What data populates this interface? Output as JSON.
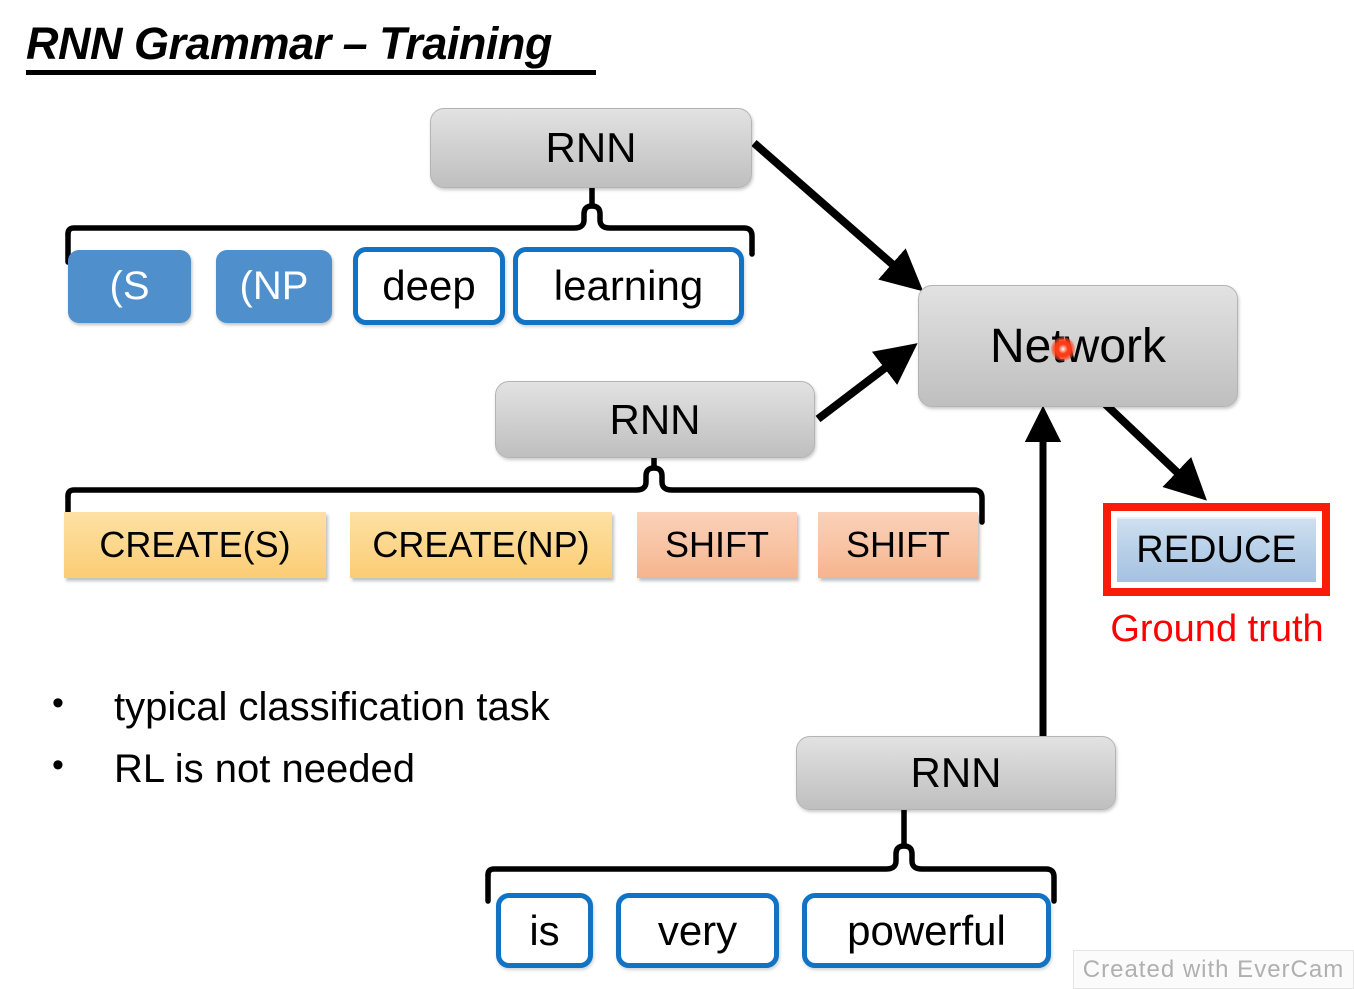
{
  "slide": {
    "title": "RNN Grammar – Training",
    "background_color": "#ffffff"
  },
  "colors": {
    "node_gray": "#d3d3d3",
    "token_blue": "#4e8fcc",
    "word_border_blue": "#1273c4",
    "create_yellow": "#fcd68a",
    "shift_orange": "#f8c3a3",
    "reduce_fill": "#b7cfe8",
    "ground_truth_red": "#ff0000",
    "highlight_red": "#f91c06",
    "laser_pointer_red": "#ff3b18"
  },
  "nodes": {
    "rnn_top": {
      "label": "RNN"
    },
    "rnn_middle": {
      "label": "RNN"
    },
    "rnn_bottom": {
      "label": "RNN"
    },
    "network": {
      "label": "Network"
    }
  },
  "stack_tokens": [
    {
      "label": "(S",
      "style": "blue-fill"
    },
    {
      "label": "(NP",
      "style": "blue-fill"
    },
    {
      "label": "deep",
      "style": "blue-outline"
    },
    {
      "label": "learning",
      "style": "blue-outline"
    }
  ],
  "action_tokens": [
    {
      "label": "CREATE(S)",
      "style": "create"
    },
    {
      "label": "CREATE(NP)",
      "style": "create"
    },
    {
      "label": "SHIFT",
      "style": "shift"
    },
    {
      "label": "SHIFT",
      "style": "shift"
    }
  ],
  "buffer_tokens": [
    {
      "label": "is",
      "style": "blue-outline"
    },
    {
      "label": "very",
      "style": "blue-outline"
    },
    {
      "label": "powerful",
      "style": "blue-outline"
    }
  ],
  "output": {
    "reduce_label": "REDUCE",
    "ground_truth_caption": "Ground truth"
  },
  "bullets": [
    {
      "marker": "•",
      "text": "typical classification task"
    },
    {
      "marker": "•",
      "text": "RL is not needed"
    }
  ],
  "watermark": {
    "text": "Created with EverCam"
  }
}
